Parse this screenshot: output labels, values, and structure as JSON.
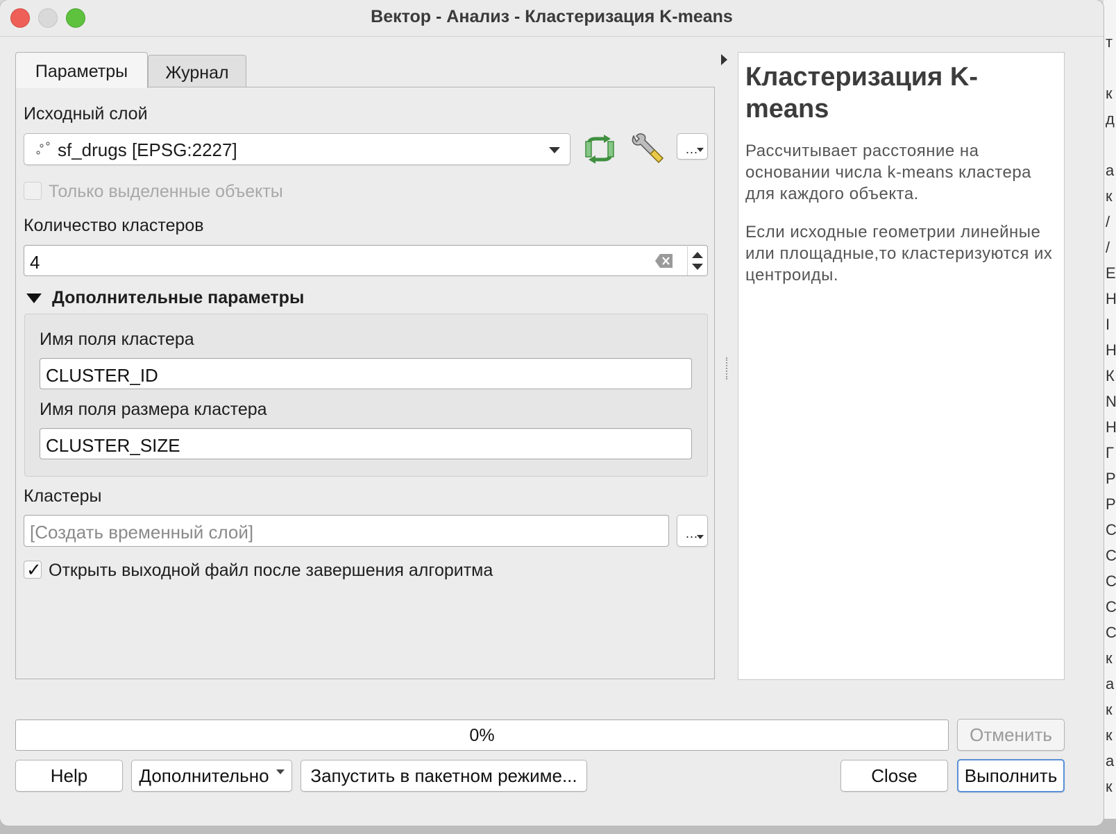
{
  "window": {
    "title": "Вектор - Анализ - Кластеризация K-means"
  },
  "tabs": [
    {
      "label": "Параметры",
      "active": true
    },
    {
      "label": "Журнал",
      "active": false
    }
  ],
  "params": {
    "input_layer_label": "Исходный слой",
    "input_layer_value": "sf_drugs [EPSG:2227]",
    "selected_only_label": "Только выделенные объекты",
    "selected_only_checked": false,
    "clusters_count_label": "Количество кластеров",
    "clusters_count_value": "4",
    "advanced_label": "Дополнительные параметры",
    "cluster_field_label": "Имя поля кластера",
    "cluster_field_value": "CLUSTER_ID",
    "cluster_size_field_label": "Имя поля размера кластера",
    "cluster_size_field_value": "CLUSTER_SIZE",
    "output_label": "Кластеры",
    "output_placeholder": "[Создать временный слой]",
    "open_output_label": "Открыть выходной файл после завершения алгоритма",
    "open_output_checked": true,
    "more_button": "...",
    "checkmark": "✓"
  },
  "help": {
    "title": "Кластеризация K-means",
    "paragraph1": "Рассчитывает расстояние на основании числа k-means кластера для каждого объекта.",
    "paragraph2": "Если исходные геометрии линейные или площадные,то кластеризуются их центроиды."
  },
  "progress": {
    "value": 0,
    "label": "0%"
  },
  "buttons": {
    "cancel": "Отменить",
    "help": "Help",
    "advanced": "Дополнительно",
    "batch": "Запустить в пакетном режиме...",
    "close": "Close",
    "run": "Выполнить"
  },
  "background_window": {
    "visible_chars": [
      "т",
      "",
      "к",
      "д",
      "",
      "а",
      "к",
      "/",
      "/",
      "Е",
      "Н",
      "I",
      "Н",
      "К",
      "N",
      "Н",
      "Г",
      "Р",
      "Р",
      "С",
      "С",
      "С",
      "С",
      "С",
      "к",
      "а",
      "к",
      "к",
      "а",
      "к"
    ]
  },
  "colors": {
    "accent": "#3d84f7",
    "refresh_icon": "#4a9a4a",
    "close_light": "#ee5f57",
    "max_light": "#5fc23f"
  }
}
